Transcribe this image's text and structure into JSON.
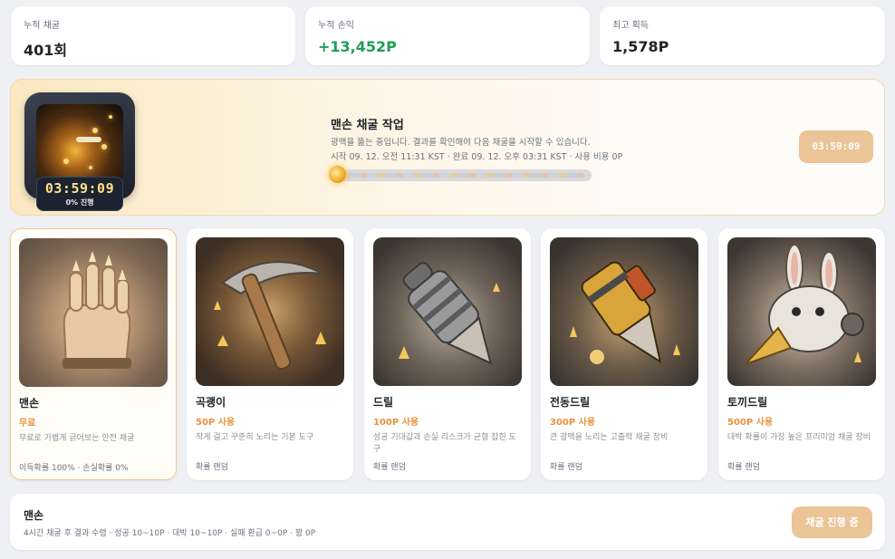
{
  "stats": [
    {
      "label": "누적 채굴",
      "value": "401회"
    },
    {
      "label": "누적 손익",
      "value": "+13,452P"
    },
    {
      "label": "최고 획득",
      "value": "1,578P"
    }
  ],
  "job": {
    "title": "맨손 채굴 작업",
    "description": "광맥을 뚫는 중입니다. 결과를 확인해야 다음 채굴을 시작할 수 있습니다.",
    "meta": "시작 09. 12. 오전 11:31 KST · 완료 09. 12. 오후 03:31 KST · 사용 비용 0P",
    "timer": "03:59:09",
    "progress_label": "0% 진행",
    "progress_fraction": 0.0,
    "timer_button": "03:59:09"
  },
  "tools": [
    {
      "name": "맨손",
      "cost": "무료",
      "description": "무료로 가볍게 긁어보는 안전 채굴",
      "odds": "이득확률 100% · 손실확률 0%",
      "icon": "glove-icon",
      "selected": true
    },
    {
      "name": "곡괭이",
      "cost": "50P 사용",
      "description": "작게 걸고 꾸준히 노리는 기본 도구",
      "odds": "확률 랜덤",
      "icon": "pickaxe-icon",
      "selected": false
    },
    {
      "name": "드릴",
      "cost": "100P 사용",
      "description": "성공 기대값과 손실 리스크가 균형 잡힌 도구",
      "odds": "확률 랜덤",
      "icon": "drill-icon",
      "selected": false
    },
    {
      "name": "전동드릴",
      "cost": "300P 사용",
      "description": "큰 광맥을 노리는 고출력 채굴 장비",
      "odds": "확률 랜덤",
      "icon": "electric-drill-icon",
      "selected": false
    },
    {
      "name": "토끼드릴",
      "cost": "500P 사용",
      "description": "대박 확률이 가장 높은 프리미엄 채굴 장비",
      "odds": "확률 랜덤",
      "icon": "rabbit-drill-icon",
      "selected": false
    }
  ],
  "footer": {
    "title": "맨손",
    "description": "4시간 채굴 후 결과 수령 · 성공 10~10P · 대박 10~10P · 실패 환급 0~0P · 꽝 0P",
    "button": "채굴 진행 중"
  },
  "colors": {
    "accent": "#e6923a",
    "positive": "#1f9d55",
    "button_disabled": "#ebc497"
  }
}
